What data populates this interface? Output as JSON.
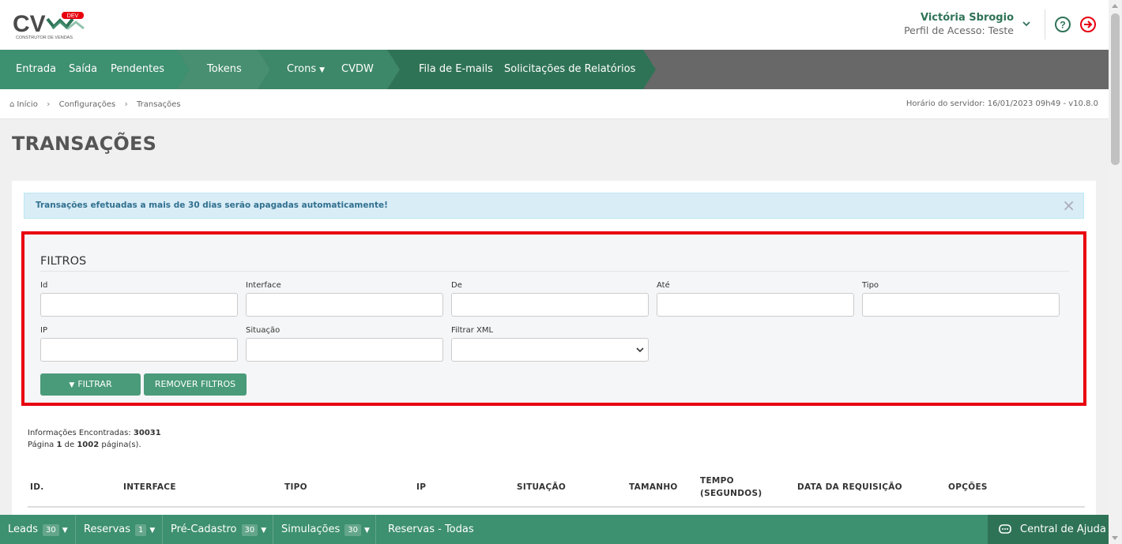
{
  "header": {
    "logo_text": "CV",
    "logo_badge": "DEV",
    "logo_subtitle": "CONSTRUTOR DE VENDAS",
    "user_name": "Victória Sbrogio",
    "user_profile": "Perfil de Acesso: Teste"
  },
  "nav": {
    "items": [
      {
        "label": "Entrada"
      },
      {
        "label": "Saída"
      },
      {
        "label": "Pendentes"
      },
      {
        "label": "Tokens"
      },
      {
        "label": "Crons"
      },
      {
        "label": "CVDW"
      },
      {
        "label": "Fila de E-mails"
      },
      {
        "label": "Solicitações de Relatórios"
      }
    ],
    "colors": {
      "segment_1": "#3d9070",
      "segment_2": "#478f70",
      "segment_3": "#3d8868",
      "segment_4": "#2f7357"
    }
  },
  "breadcrumb": {
    "items": [
      "Início",
      "Configurações",
      "Transações"
    ],
    "server_time": "Horário do servidor: 16/01/2023 09h49 - v10.8.0"
  },
  "page": {
    "title": "TRANSAÇÕES",
    "alert": "Transações efetuadas a mais de 30 dias serão apagadas automaticamente!",
    "alert_close": "×"
  },
  "filters": {
    "title": "FILTROS",
    "fields": {
      "id": {
        "label": "Id",
        "value": ""
      },
      "interface": {
        "label": "Interface",
        "value": ""
      },
      "de": {
        "label": "De",
        "value": ""
      },
      "ate": {
        "label": "Até",
        "value": ""
      },
      "tipo": {
        "label": "Tipo",
        "value": ""
      },
      "ip": {
        "label": "IP",
        "value": ""
      },
      "situacao": {
        "label": "Situação",
        "value": ""
      },
      "xml": {
        "label": "Filtrar XML",
        "value": ""
      }
    },
    "filter_button": "FILTRAR",
    "remove_button": "REMOVER FILTROS"
  },
  "results": {
    "found_label": "Informações Encontradas:",
    "found_count": "30031",
    "page_prefix": "Página",
    "page_current": "1",
    "page_of": "de",
    "page_total": "1002",
    "page_suffix": "página(s)."
  },
  "table": {
    "headers": [
      "ID.",
      "INTERFACE",
      "TIPO",
      "IP",
      "SITUAÇÃO",
      "TAMANHO",
      "TEMPO (SEGUNDOS)",
      "DATA DA REQUISIÇÃO",
      "OPÇÕES"
    ]
  },
  "bottombar": {
    "items": [
      {
        "label": "Leads",
        "count": "30"
      },
      {
        "label": "Reservas",
        "count": "1"
      },
      {
        "label": "Pré-Cadastro",
        "count": "30"
      },
      {
        "label": "Simulações",
        "count": "30"
      }
    ],
    "reservas_todas": "Reservas - Todas",
    "help_center": "Central de Ajuda"
  },
  "icons": {
    "home": "home-icon",
    "help": "question-circle-icon",
    "logout": "sign-out-icon",
    "filter": "funnel-icon",
    "chat": "chat-bubble-icon"
  },
  "colors": {
    "brand_green": "#2f7357",
    "accent_red": "#e8000f",
    "button_green": "#4a9b7a",
    "alert_bg": "#d9edf7"
  }
}
